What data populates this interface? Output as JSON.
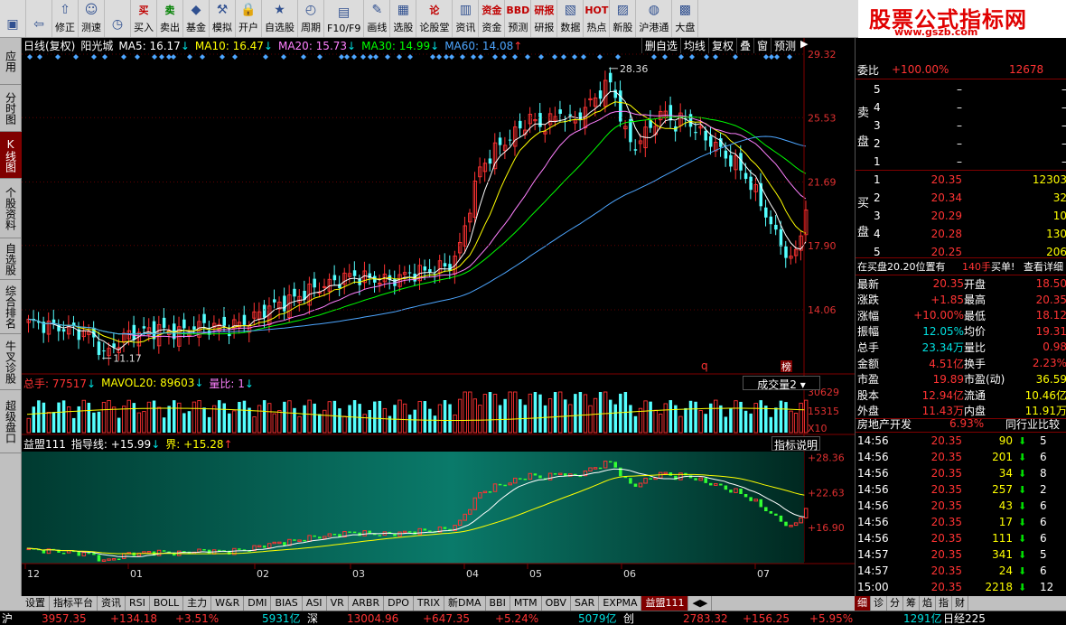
{
  "toolbar": {
    "items": [
      {
        "label": "",
        "icon": "logo-icon"
      },
      {
        "label": "",
        "icon": "back-arrow-icon"
      },
      {
        "label": "修正",
        "icon": "up-arrow-icon"
      },
      {
        "label": "测速",
        "icon": "speed-icon"
      },
      {
        "label": "",
        "icon": "clock-icon"
      },
      {
        "label": "买入",
        "icon": "buy-icon",
        "glyph": "买"
      },
      {
        "label": "卖出",
        "icon": "sell-icon",
        "glyph": "卖"
      },
      {
        "label": "基金",
        "icon": "fund-icon"
      },
      {
        "label": "模拟",
        "icon": "hammer-icon"
      },
      {
        "label": "开户",
        "icon": "lock-icon"
      },
      {
        "label": "自选股",
        "icon": "star-icon"
      },
      {
        "label": "周期",
        "icon": "period-icon"
      },
      {
        "label": "F10/F9",
        "icon": "f10-icon"
      },
      {
        "label": "画线",
        "icon": "pen-icon"
      },
      {
        "label": "选股",
        "icon": "select-icon"
      },
      {
        "label": "论股堂",
        "icon": "forum-icon",
        "glyph": "论"
      },
      {
        "label": "资讯",
        "icon": "news-icon"
      },
      {
        "label": "资金",
        "icon": "money-icon",
        "glyph": "资金"
      },
      {
        "label": "预测",
        "icon": "bbd-icon",
        "glyph": "BBD"
      },
      {
        "label": "研报",
        "icon": "report-icon",
        "glyph": "研报"
      },
      {
        "label": "数据",
        "icon": "data-icon"
      },
      {
        "label": "热点",
        "icon": "hot-icon",
        "glyph": "HOT"
      },
      {
        "label": "新股",
        "icon": "newstock-icon"
      },
      {
        "label": "沪港通",
        "icon": "hk-icon"
      },
      {
        "label": "大盘",
        "icon": "market-icon"
      }
    ]
  },
  "watermark": {
    "line1": "股票公式指标网",
    "line2": "www.gszb.com"
  },
  "left_tabs": [
    {
      "label": "应用",
      "active": false
    },
    {
      "label": "分时图",
      "active": false
    },
    {
      "label": "K线图",
      "active": true
    },
    {
      "label": "个股资料",
      "active": false
    },
    {
      "label": "自选股",
      "active": false
    },
    {
      "label": "综合排名",
      "active": false
    },
    {
      "label": "牛叉诊股",
      "active": false
    },
    {
      "label": "超级盘口",
      "active": false
    }
  ],
  "chart_info": {
    "title": "日线(复权)",
    "stock": "阳光城",
    "ma5": "MA5: 16.17",
    "ma10": "MA10: 16.47",
    "ma20": "MA20: 15.73",
    "ma30": "MA30: 14.99",
    "ma60": "MA60: 14.08",
    "buttons": [
      "删自选",
      "均线",
      "复权",
      "叠",
      "窗",
      "预测"
    ]
  },
  "price_axis": [
    "29.32",
    "25.53",
    "21.69",
    "17.90",
    "14.06"
  ],
  "annotations": {
    "high": "28.36",
    "low": "11.17",
    "mark": "q",
    "badge": "榜"
  },
  "volume": {
    "total": "总手: 77517",
    "mavol": "MAVOL20: 89603",
    "ratio": "量比: 1",
    "selector": "成交量2",
    "axis": [
      "30629",
      "15315",
      "X10"
    ]
  },
  "indicator": {
    "name": "益盟111",
    "guide": "指导线: +15.99",
    "bound": "界: +15.28",
    "button": "指标说明",
    "axis": [
      "+28.36",
      "+22.63",
      "+16.90"
    ]
  },
  "x_axis": [
    "12",
    "01",
    "02",
    "03",
    "04",
    "05",
    "06",
    "07"
  ],
  "colors": {
    "up": "#ff3333",
    "down": "#54ffff",
    "ma5": "#ffffff",
    "ma10": "#ffff00",
    "ma20": "#ff80ff",
    "ma30": "#00ff00",
    "ma60": "#4da6ff"
  },
  "order_book": {
    "ratio_label": "委比",
    "ratio_value": "+100.00%",
    "ratio_count": "12678",
    "sell_label": "卖盘",
    "buy_label": "买盘",
    "sell": [
      {
        "level": "5",
        "price": "–",
        "vol": "–"
      },
      {
        "level": "4",
        "price": "–",
        "vol": "–"
      },
      {
        "level": "3",
        "price": "–",
        "vol": "–"
      },
      {
        "level": "2",
        "price": "–",
        "vol": "–"
      },
      {
        "level": "1",
        "price": "–",
        "vol": "–"
      }
    ],
    "buy": [
      {
        "level": "1",
        "price": "20.35",
        "vol": "12303"
      },
      {
        "level": "2",
        "price": "20.34",
        "vol": "32"
      },
      {
        "level": "3",
        "price": "20.29",
        "vol": "10"
      },
      {
        "level": "4",
        "price": "20.28",
        "vol": "130"
      },
      {
        "level": "5",
        "price": "20.25",
        "vol": "206"
      }
    ],
    "notice_a": "在买盘20.20位置有",
    "notice_b": "140手",
    "notice_c": "买单!",
    "notice_d": "查看详细"
  },
  "quote": [
    {
      "l": "最新",
      "v": "20.35",
      "l2": "开盘",
      "v2": "18.50"
    },
    {
      "l": "涨跌",
      "v": "+1.85",
      "l2": "最高",
      "v2": "20.35"
    },
    {
      "l": "涨幅",
      "v": "+10.00%",
      "l2": "最低",
      "v2": "18.12"
    },
    {
      "l": "振幅",
      "v": "12.05%",
      "l2": "均价",
      "v2": "19.31"
    },
    {
      "l": "总手",
      "v": "23.34万",
      "l2": "量比",
      "v2": "0.98"
    },
    {
      "l": "金额",
      "v": "4.51亿",
      "l2": "换手",
      "v2": "2.23%"
    },
    {
      "l": "市盈",
      "v": "19.89",
      "l2": "市盈(动)",
      "v2": "36.59"
    },
    {
      "l": "股本",
      "v": "12.94亿",
      "l2": "流通",
      "v2": "10.46亿"
    },
    {
      "l": "外盘",
      "v": "11.43万",
      "l2": "内盘",
      "v2": "11.91万"
    }
  ],
  "sector": {
    "name": "房地产开发",
    "pct": "6.93%",
    "link": "同行业比较"
  },
  "ticks": [
    {
      "t": "14:56",
      "p": "20.35",
      "v": "90",
      "s": "5"
    },
    {
      "t": "14:56",
      "p": "20.35",
      "v": "201",
      "s": "6"
    },
    {
      "t": "14:56",
      "p": "20.35",
      "v": "34",
      "s": "8"
    },
    {
      "t": "14:56",
      "p": "20.35",
      "v": "257",
      "s": "2"
    },
    {
      "t": "14:56",
      "p": "20.35",
      "v": "43",
      "s": "6"
    },
    {
      "t": "14:56",
      "p": "20.35",
      "v": "17",
      "s": "6"
    },
    {
      "t": "14:56",
      "p": "20.35",
      "v": "111",
      "s": "6"
    },
    {
      "t": "14:57",
      "p": "20.35",
      "v": "341",
      "s": "5"
    },
    {
      "t": "14:57",
      "p": "20.35",
      "v": "24",
      "s": "6"
    },
    {
      "t": "15:00",
      "p": "20.35",
      "v": "2218",
      "s": "12"
    }
  ],
  "bottom_tabs": [
    "设置",
    "指标平台",
    "资讯",
    "RSI",
    "BOLL",
    "主力",
    "W&R",
    "DMI",
    "BIAS",
    "ASI",
    "VR",
    "ARBR",
    "DPO",
    "TRIX",
    "新DMA",
    "BBI",
    "MTM",
    "OBV",
    "SAR",
    "EXPMA",
    "益盟111"
  ],
  "right_tabs": [
    "细",
    "诊",
    "分",
    "筹",
    "焰",
    "指",
    "财"
  ],
  "status": {
    "sh_label": "沪",
    "sh_index": "3957.35",
    "sh_change": "+134.18",
    "sh_pct": "+3.51%",
    "sh_amount": "5931亿",
    "sz_label": "深",
    "sz_index": "13004.96",
    "sz_change": "+647.35",
    "sz_pct": "+5.24%",
    "sz_amount": "5079亿",
    "cy_label": "创",
    "cy_index": "2783.32",
    "cy_change": "+156.25",
    "cy_pct": "+5.95%",
    "cy_amount": "1291亿",
    "extra": "日经225"
  }
}
